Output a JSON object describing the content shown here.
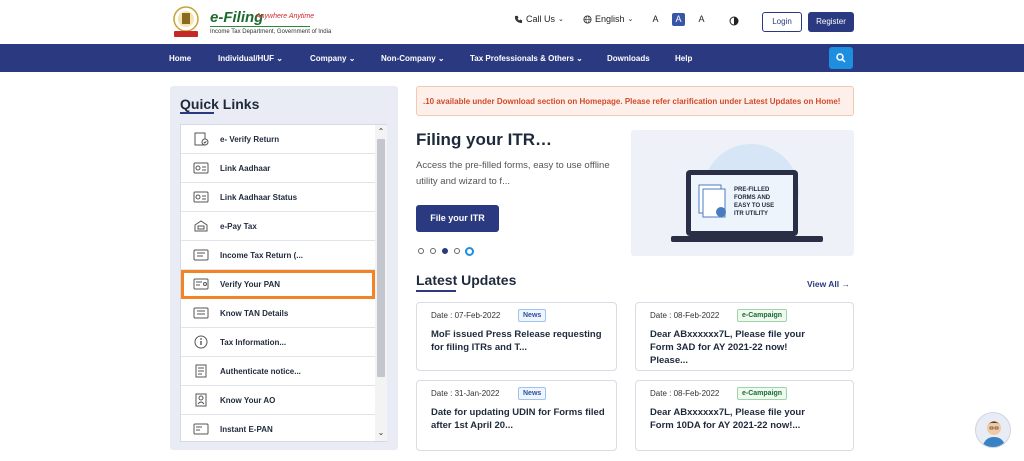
{
  "logo": {
    "title": "e-Filing",
    "tagline": "Anywhere Anytime",
    "subtitle": "Income Tax Department, Government of India"
  },
  "header": {
    "call_us": "Call Us",
    "language": "English",
    "font_small": "A",
    "font_normal": "A",
    "font_large": "A",
    "login": "Login",
    "register": "Register"
  },
  "nav": {
    "items": [
      "Home",
      "Individual/HUF",
      "Company",
      "Non-Company",
      "Tax Professionals & Others",
      "Downloads",
      "Help"
    ]
  },
  "quick_links": {
    "title": "Quick Links",
    "items": [
      {
        "label": "e- Verify Return",
        "icon": "verify-return-icon"
      },
      {
        "label": "Link Aadhaar",
        "icon": "aadhaar-card-icon"
      },
      {
        "label": "Link Aadhaar Status",
        "icon": "aadhaar-status-icon"
      },
      {
        "label": "e-Pay Tax",
        "icon": "pay-tax-icon"
      },
      {
        "label": "Income Tax Return (...",
        "icon": "tax-return-icon"
      },
      {
        "label": "Verify Your PAN",
        "icon": "pan-card-icon"
      },
      {
        "label": "Know TAN Details",
        "icon": "tan-details-icon"
      },
      {
        "label": "Tax Information...",
        "icon": "info-icon"
      },
      {
        "label": "Authenticate notice...",
        "icon": "notice-icon"
      },
      {
        "label": "Know Your AO",
        "icon": "officer-icon"
      },
      {
        "label": "Instant E-PAN",
        "icon": "epan-icon"
      }
    ]
  },
  "marquee": ".10 available under Download section on Homepage. Please refer clarification under Latest Updates on Home!",
  "hero": {
    "title": "Filing your ITR…",
    "text": "Access the pre-filled forms, easy to use offline utility and wizard to f...",
    "button": "File your ITR",
    "banner_text": [
      "PRE-FILLED",
      "FORMS AND",
      "EASY TO USE",
      "ITR UTILITY"
    ]
  },
  "latest": {
    "title": "Latest Updates",
    "view_all": "View All",
    "cards": [
      {
        "date": "Date : 07-Feb-2022",
        "badge": "News",
        "text": "MoF issued Press Release requesting for filing ITRs and T..."
      },
      {
        "date": "Date : 08-Feb-2022",
        "badge": "e-Campaign",
        "text": "Dear ABxxxxxx7L, Please file your Form 3AD for AY 2021-22 now! Please..."
      },
      {
        "date": "Date : 31-Jan-2022",
        "badge": "News",
        "text": "Date for updating UDIN for Forms filed after 1st April 20..."
      },
      {
        "date": "Date : 08-Feb-2022",
        "badge": "e-Campaign",
        "text": "Dear ABxxxxxx7L, Please file your Form 10DA for AY 2021-22 now!..."
      }
    ]
  },
  "colors": {
    "primary": "#2b3a80",
    "accent": "#1e8fde",
    "highlight": "#f28425",
    "alert_text": "#d24a2a"
  }
}
